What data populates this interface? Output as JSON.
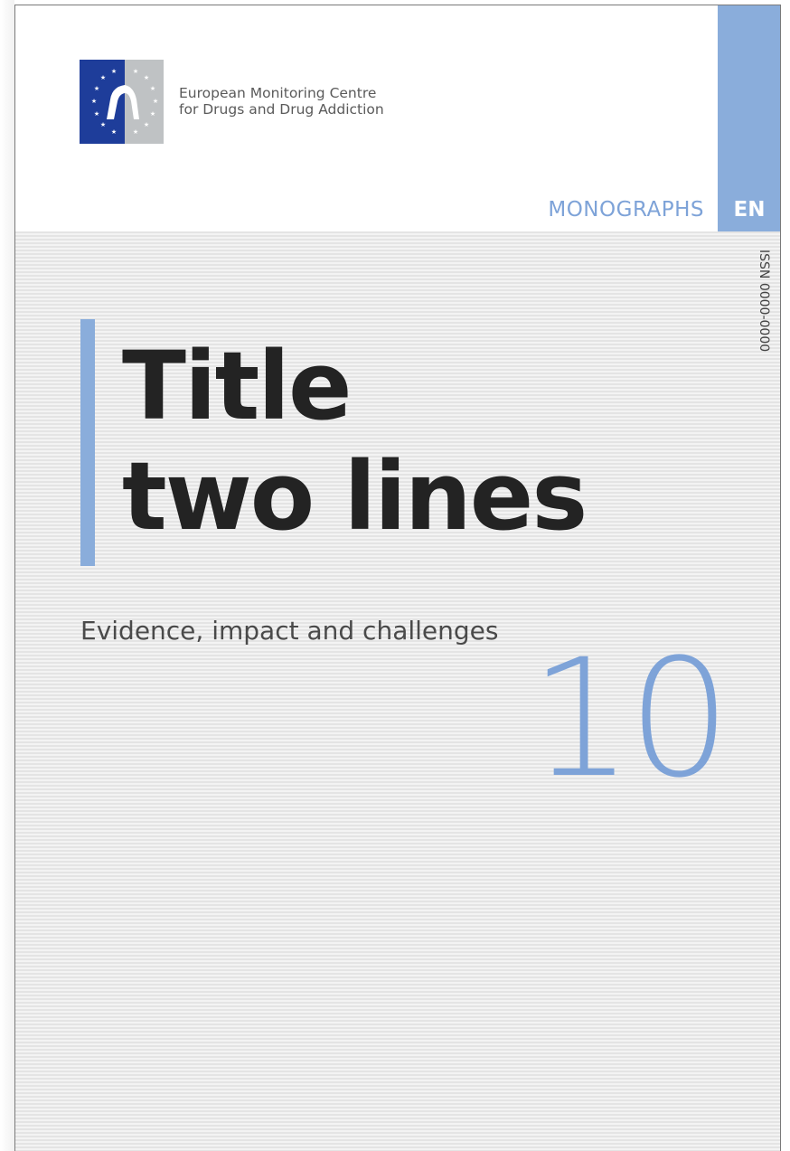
{
  "organization": {
    "name_line1": "European Monitoring Centre",
    "name_line2": "for Drugs and Drug Addiction"
  },
  "series": {
    "label": "MONOGRAPHS",
    "language": "EN"
  },
  "issn": "ISSN 0000-0000",
  "title": {
    "line1": "Title",
    "line2": "two lines"
  },
  "subtitle": "Evidence, impact and challenges",
  "issue_number": "10",
  "colors": {
    "accent_blue": "#8aaddb",
    "series_text": "#7ea3d8",
    "logo_blue": "#1e3d9a",
    "logo_grey": "#bfc2c4",
    "title_text": "#232323"
  },
  "icons": {
    "logo": "emcdda-logo-icon"
  }
}
